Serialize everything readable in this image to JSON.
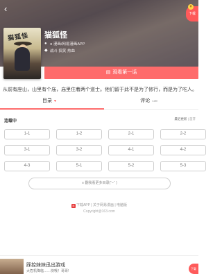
{
  "header": {
    "back_icon": "back-arrow-icon",
    "download_badge": "下载",
    "download_badge_dot": "¥"
  },
  "comic": {
    "cover_title": "猫狐怪",
    "title": "猫狐怪",
    "source": "● 漫画/网易漫画APP",
    "tags": "战斗 搞笑 热血",
    "description": "从前有座山，山里有个庙，庙里住着两个道士。他们留于此不是为了修行，而是为了吃人。",
    "read_button": "观看第一话"
  },
  "tabs": {
    "directory": "目录",
    "directory_arrow": "▼",
    "comments": "评论",
    "comments_count": "138"
  },
  "chapters": {
    "status": "连载中",
    "sort_update": "最近更新",
    "sort_sep": " | ",
    "sort_asc": "首开",
    "items": [
      "1-1",
      "1-2",
      "2-1",
      "2-2",
      "3-1",
      "3-2",
      "4-1",
      "4-2",
      "4-3",
      "5-1",
      "5-2",
      "5-3"
    ],
    "more": "≡ 翻我看更多目录(˘⌣˘ )"
  },
  "footer": {
    "links": "下载APP | 关于网易漫画 | 电脑版",
    "copyright": "Copyright@163.com"
  },
  "banner": {
    "line1": "踩控妹妹迅出游戏",
    "line2": "大危机降临……快哦！哥哥!",
    "download": "下载"
  },
  "colors": {
    "accent": "#fe6b6b",
    "badge": "#fe5a5a"
  }
}
